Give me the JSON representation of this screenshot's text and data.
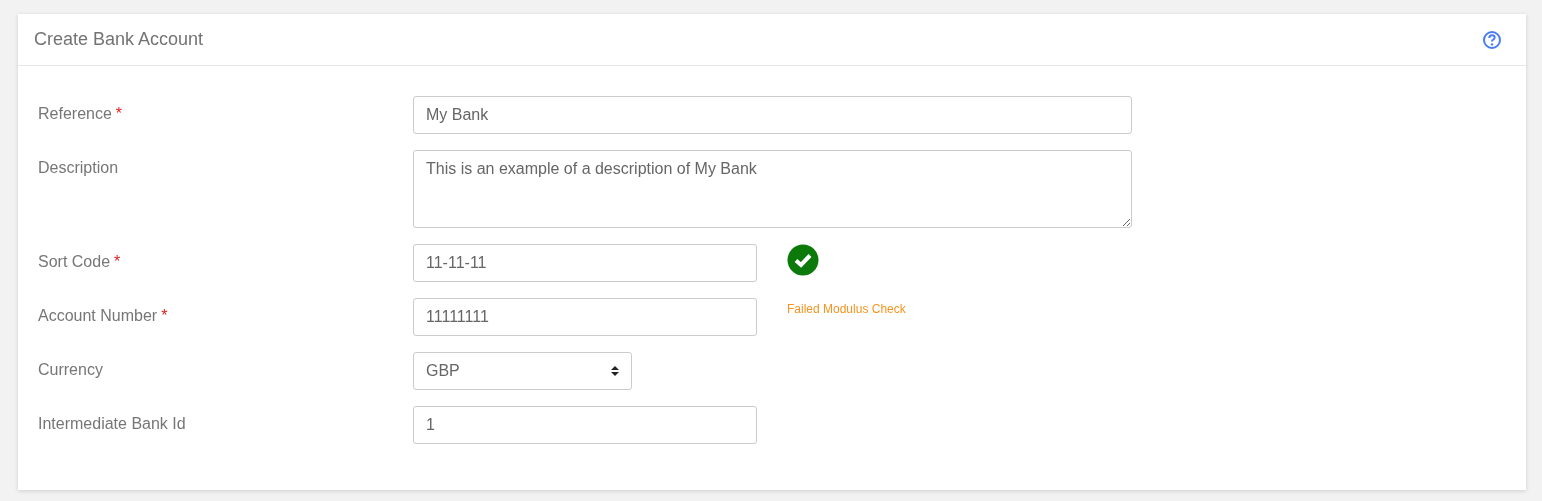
{
  "panel": {
    "title": "Create Bank Account"
  },
  "fields": [
    {
      "label": "Reference",
      "required_mark": "*",
      "kind": "text",
      "value": "My Bank"
    },
    {
      "label": "Description",
      "kind": "textarea",
      "value": "This is an example of a description of My Bank"
    },
    {
      "label": "Sort Code",
      "required_mark": "*",
      "kind": "text",
      "value": "11-11-11",
      "valid": true
    },
    {
      "label": "Account Number",
      "required_mark": "*",
      "kind": "text",
      "value": "11111111",
      "message": "Failed Modulus Check"
    },
    {
      "label": "Currency",
      "kind": "select",
      "value": "GBP"
    },
    {
      "label": "Intermediate Bank Id",
      "kind": "text",
      "value": "1"
    }
  ]
}
